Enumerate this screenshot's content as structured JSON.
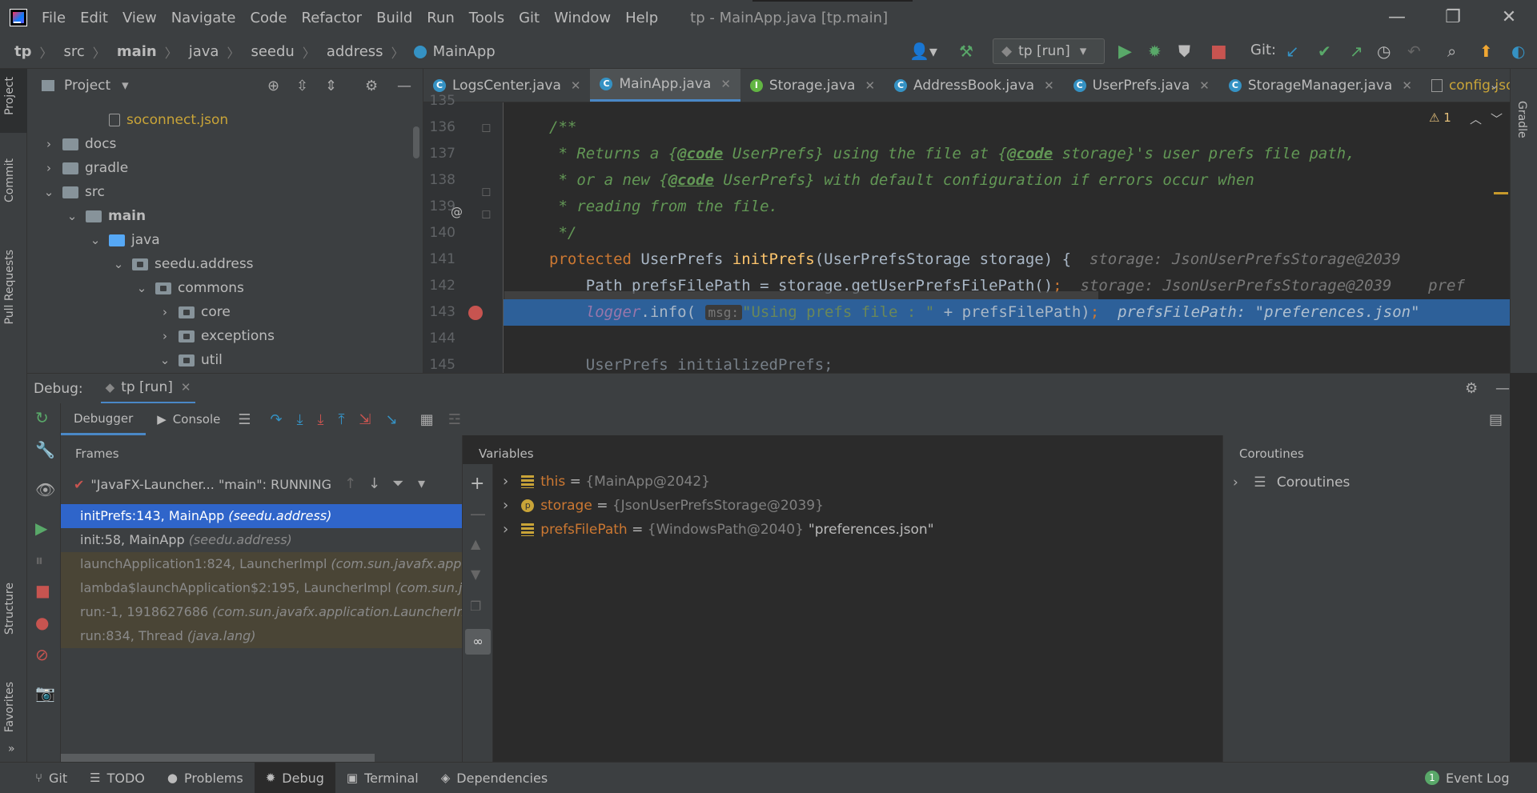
{
  "menu": [
    "File",
    "Edit",
    "View",
    "Navigate",
    "Code",
    "Refactor",
    "Build",
    "Run",
    "Tools",
    "Git",
    "Window",
    "Help"
  ],
  "window_title": "tp - MainApp.java [tp.main]",
  "breadcrumbs": [
    "tp",
    "src",
    "main",
    "java",
    "seedu",
    "address",
    "MainApp"
  ],
  "run_config": "tp [run]",
  "git_label": "Git:",
  "left_stripe": [
    "Project",
    "Commit",
    "Pull Requests",
    "Structure",
    "Favorites"
  ],
  "right_stripe": [
    "Gradle"
  ],
  "project": {
    "title": "Project",
    "tree": [
      {
        "label": "soconnect.json",
        "depth": 3,
        "type": "file",
        "expanded": null
      },
      {
        "label": "docs",
        "depth": 1,
        "type": "folder",
        "expanded": false
      },
      {
        "label": "gradle",
        "depth": 1,
        "type": "folder",
        "expanded": false
      },
      {
        "label": "src",
        "depth": 1,
        "type": "folder",
        "expanded": true
      },
      {
        "label": "main",
        "depth": 2,
        "type": "folder",
        "expanded": true
      },
      {
        "label": "java",
        "depth": 3,
        "type": "src",
        "expanded": true
      },
      {
        "label": "seedu.address",
        "depth": 4,
        "type": "pkg",
        "expanded": true
      },
      {
        "label": "commons",
        "depth": 5,
        "type": "pkg",
        "expanded": true
      },
      {
        "label": "core",
        "depth": 6,
        "type": "pkg",
        "expanded": false
      },
      {
        "label": "exceptions",
        "depth": 6,
        "type": "pkg",
        "expanded": false
      },
      {
        "label": "util",
        "depth": 6,
        "type": "pkg",
        "expanded": true
      }
    ]
  },
  "editor": {
    "tabs": [
      {
        "label": "LogsCenter.java",
        "icon": "C",
        "active": false
      },
      {
        "label": "MainApp.java",
        "icon": "C",
        "active": true
      },
      {
        "label": "Storage.java",
        "icon": "I",
        "active": false
      },
      {
        "label": "AddressBook.java",
        "icon": "C",
        "active": false
      },
      {
        "label": "UserPrefs.java",
        "icon": "C",
        "active": false
      },
      {
        "label": "StorageManager.java",
        "icon": "C",
        "active": false
      },
      {
        "label": "config.json",
        "icon": "json",
        "active": false
      }
    ],
    "warnings": "1",
    "lines": [
      "135",
      "136",
      "137",
      "138",
      "139",
      "140",
      "141",
      "142",
      "143",
      "144",
      "145"
    ],
    "code": {
      "l136": "/**",
      "l137a": " * Returns a {",
      "l137b": "@code",
      "l137c": " UserPrefs} using the file at {",
      "l137d": "@code",
      "l137e": " storage}'s user prefs file path,",
      "l138a": " * or a new {",
      "l138b": "@code",
      "l138c": " UserPrefs} with default configuration if errors occur when",
      "l139": " * reading from the file.",
      "l140": " */",
      "l141a": "protected ",
      "l141b": "UserPrefs ",
      "l141c": "initPrefs",
      "l141d": "(UserPrefsStorage storage) {",
      "l141hint": "storage: JsonUserPrefsStorage@2039",
      "l142a": "    Path prefsFilePath = storage.getUserPrefsFilePath()",
      "l142b": ";",
      "l142hint": "storage: JsonUserPrefsStorage@2039    pref",
      "l143a": "    ",
      "l143b": "logger",
      "l143c": ".info(",
      "l143param": "msg:",
      "l143d": "\"Using prefs file : \"",
      "l143e": " + prefsFilePath)",
      "l143f": ";",
      "l143hint": "prefsFilePath: \"preferences.json\"",
      "l145": "    UserPrefs initializedPrefs;"
    }
  },
  "debug": {
    "label": "Debug:",
    "session": "tp [run]",
    "tabs": [
      "Debugger",
      "Console"
    ],
    "frames_title": "Frames",
    "thread": "\"JavaFX-Launcher... \"main\": RUNNING",
    "frames": [
      {
        "method": "initPrefs:143, MainApp",
        "pkg": "(seedu.address)",
        "kind": "sel"
      },
      {
        "method": "init:58, MainApp",
        "pkg": "(seedu.address)",
        "kind": "user"
      },
      {
        "method": "launchApplication1:824, LauncherImpl",
        "pkg": "(com.sun.javafx.applic",
        "kind": "lib"
      },
      {
        "method": "lambda$launchApplication$2:195, LauncherImpl",
        "pkg": "(com.sun.jav",
        "kind": "lib"
      },
      {
        "method": "run:-1, 1918627686",
        "pkg": "(com.sun.javafx.application.LauncherImp",
        "kind": "lib"
      },
      {
        "method": "run:834, Thread",
        "pkg": "(java.lang)",
        "kind": "lib"
      }
    ],
    "variables_title": "Variables",
    "variables": [
      {
        "name": "this",
        "type": "{MainApp@2042}",
        "value": "",
        "icon": "field"
      },
      {
        "name": "storage",
        "type": "{JsonUserPrefsStorage@2039}",
        "value": "",
        "icon": "param"
      },
      {
        "name": "prefsFilePath",
        "type": "{WindowsPath@2040}",
        "value": "\"preferences.json\"",
        "icon": "field"
      }
    ],
    "coroutines_title": "Coroutines",
    "coroutines_item": "Coroutines"
  },
  "statusbar": {
    "tabs": [
      {
        "label": "Git",
        "icon": "⑂"
      },
      {
        "label": "TODO",
        "icon": "☰"
      },
      {
        "label": "Problems",
        "icon": "●"
      },
      {
        "label": "Debug",
        "icon": "✹",
        "active": true
      },
      {
        "label": "Terminal",
        "icon": "▣"
      },
      {
        "label": "Dependencies",
        "icon": "◈"
      }
    ],
    "event_count": "1",
    "event_log": "Event Log"
  },
  "colors": {
    "accent": "#4a88c7",
    "selection": "#2f65ca",
    "exec_line": "#2d6099",
    "run_green": "#59a869",
    "stop_red": "#c75450"
  }
}
